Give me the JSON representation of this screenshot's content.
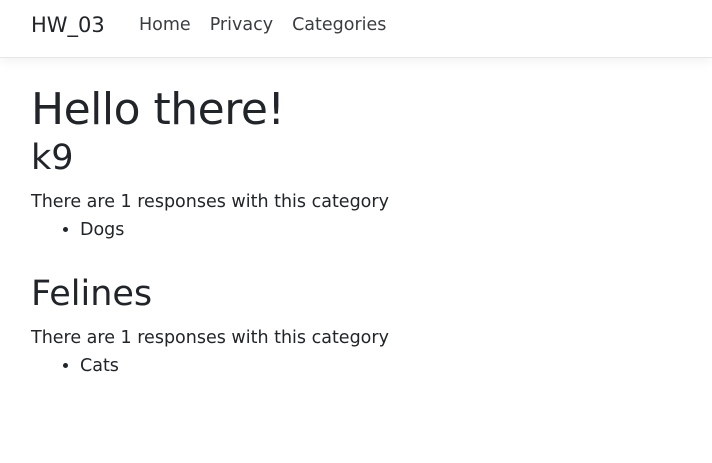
{
  "navbar": {
    "brand": "HW_03",
    "links": [
      "Home",
      "Privacy",
      "Categories"
    ]
  },
  "main": {
    "title": "Hello there!",
    "categories": [
      {
        "name": "k9",
        "summary": "There are 1 responses with this category",
        "responses": [
          "Dogs"
        ]
      },
      {
        "name": "Felines",
        "summary": "There are 1 responses with this category",
        "responses": [
          "Cats"
        ]
      }
    ]
  },
  "colors": {
    "text": "#212529",
    "nav_link": "#3a3d40",
    "background": "#ffffff"
  }
}
